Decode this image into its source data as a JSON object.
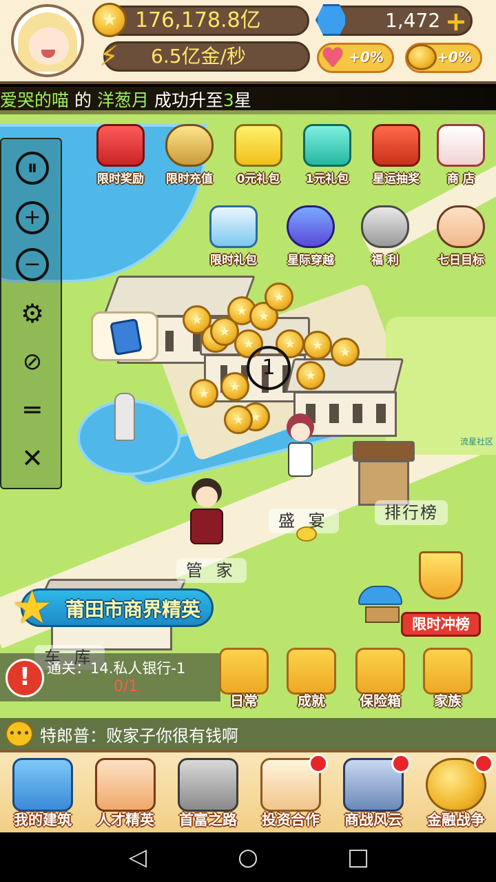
{
  "hud": {
    "gold_amount": "176,178.8亿",
    "income_rate": "6.5亿金/秒",
    "gems": "1,472",
    "buff_hearts": "+0%",
    "buff_coins": "+0%"
  },
  "broadcast": {
    "player": "爱哭的喵",
    "de": "的",
    "target": "洋葱月",
    "action": "成功升至",
    "level": "3",
    "unit": "星"
  },
  "features": [
    {
      "label": "限时奖励",
      "icon": "gift-box-icon"
    },
    {
      "label": "限时充值",
      "icon": "hourglass-icon"
    },
    {
      "label": "0元礼包",
      "icon": "gem-chest-icon"
    },
    {
      "label": "1元礼包",
      "icon": "gift-bag-icon"
    },
    {
      "label": "星运抽奖",
      "icon": "lottery-box-icon"
    },
    {
      "label": "商 店",
      "icon": "shop-icon"
    },
    {
      "label": "限时礼包",
      "icon": "timed-gift-icon"
    },
    {
      "label": "星际穿越",
      "icon": "ufo-planet-icon"
    },
    {
      "label": "福 利",
      "icon": "treasure-pot-icon"
    },
    {
      "label": "七日目标",
      "icon": "boss-avatar-icon"
    }
  ],
  "map": {
    "label_banquet": "盛 宴",
    "label_ranking": "排行榜",
    "label_butler": "管 家",
    "label_garage": "车 库",
    "watermark": "流星社区",
    "coin_count_marker": "1"
  },
  "title_banner": "莆田市商界精英",
  "quest": {
    "title": "通关：14.私人银行-1",
    "progress": "0/1"
  },
  "side_buttons": [
    {
      "label": "日常"
    },
    {
      "label": "成就"
    },
    {
      "label": "保险箱"
    },
    {
      "label": "家族"
    }
  ],
  "trophy_label": "限时冲榜",
  "chat": {
    "message": "特郎普：败家子你很有钱啊"
  },
  "bottom_nav": [
    {
      "label": "我的建筑",
      "badge": false
    },
    {
      "label": "人才精英",
      "badge": false
    },
    {
      "label": "首富之路",
      "badge": false
    },
    {
      "label": "投资合作",
      "badge": true
    },
    {
      "label": "商战风云",
      "badge": true
    },
    {
      "label": "金融战争",
      "badge": true
    }
  ]
}
